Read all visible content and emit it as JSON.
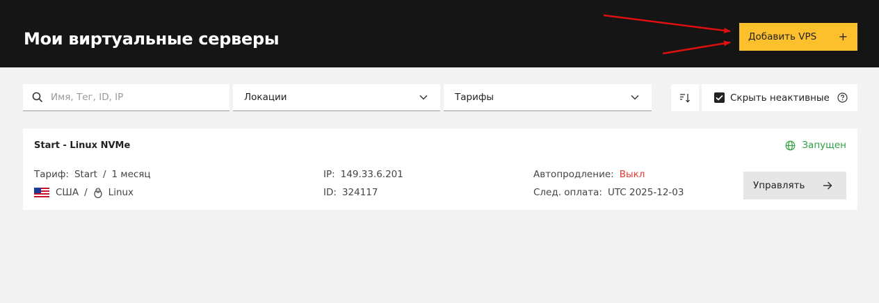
{
  "header": {
    "title": "Мои виртуальные серверы",
    "add_button": "Добавить VPS",
    "add_icon": "+"
  },
  "filters": {
    "search_placeholder": "Имя, Тег, ID, IP",
    "search_value": "",
    "locations_label": "Локации",
    "tariffs_label": "Тарифы",
    "hide_inactive_label": "Скрыть неактивные",
    "hide_inactive_checked": true
  },
  "server": {
    "name": "Start - Linux NVMe",
    "status": "Запущен",
    "tariff_label": "Тариф:",
    "tariff_value": "Start",
    "period": "1 месяц",
    "country": "США",
    "os": "Linux",
    "ip_label": "IP:",
    "ip_value": "149.33.6.201",
    "id_label": "ID:",
    "id_value": "324117",
    "autorenew_label": "Автопродление:",
    "autorenew_value": "Выкл",
    "next_payment_label": "След. оплата:",
    "next_payment_value": "UTC 2025-12-03",
    "manage_button": "Управлять",
    "separator": "/"
  },
  "colors": {
    "header_bg": "#151515",
    "accent": "#fcc02d",
    "status_ok": "#2ea043",
    "status_off": "#e53935",
    "annotation_arrow": "#e01010"
  },
  "icons": {
    "search": "search-icon",
    "dropdown": "chevron-down-icon",
    "sort": "sort-icon",
    "checkbox": "checkmark-icon",
    "help": "help-circle-icon",
    "status": "globe-icon",
    "flag": "us-flag-icon",
    "os": "linux-tux-icon",
    "manage": "arrow-right-icon"
  }
}
